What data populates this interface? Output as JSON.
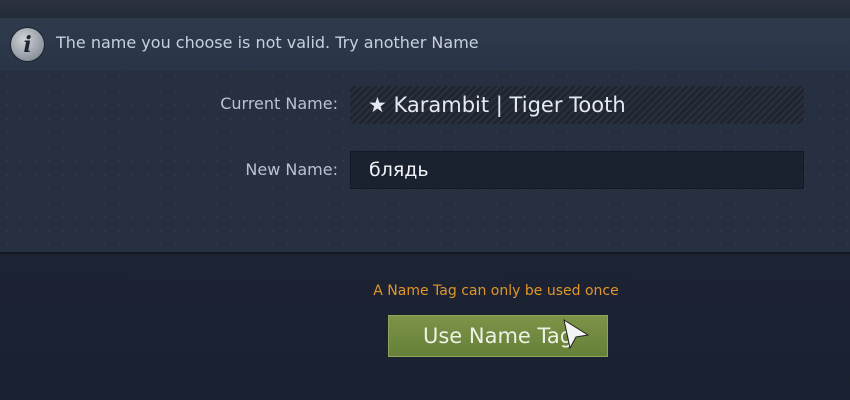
{
  "banner": {
    "icon": "info-icon",
    "message": "The name you choose is not valid. Try another Name"
  },
  "form": {
    "current_label": "Current Name:",
    "current_value": "★ Karambit | Tiger Tooth",
    "new_label": "New Name:",
    "new_value": "блядь"
  },
  "footer": {
    "warning": "A Name Tag can only be used once",
    "button_label": "Use Name Tag"
  },
  "colors": {
    "warning": "#e0952a",
    "button": "#7c9447",
    "background": "#1c2333"
  }
}
